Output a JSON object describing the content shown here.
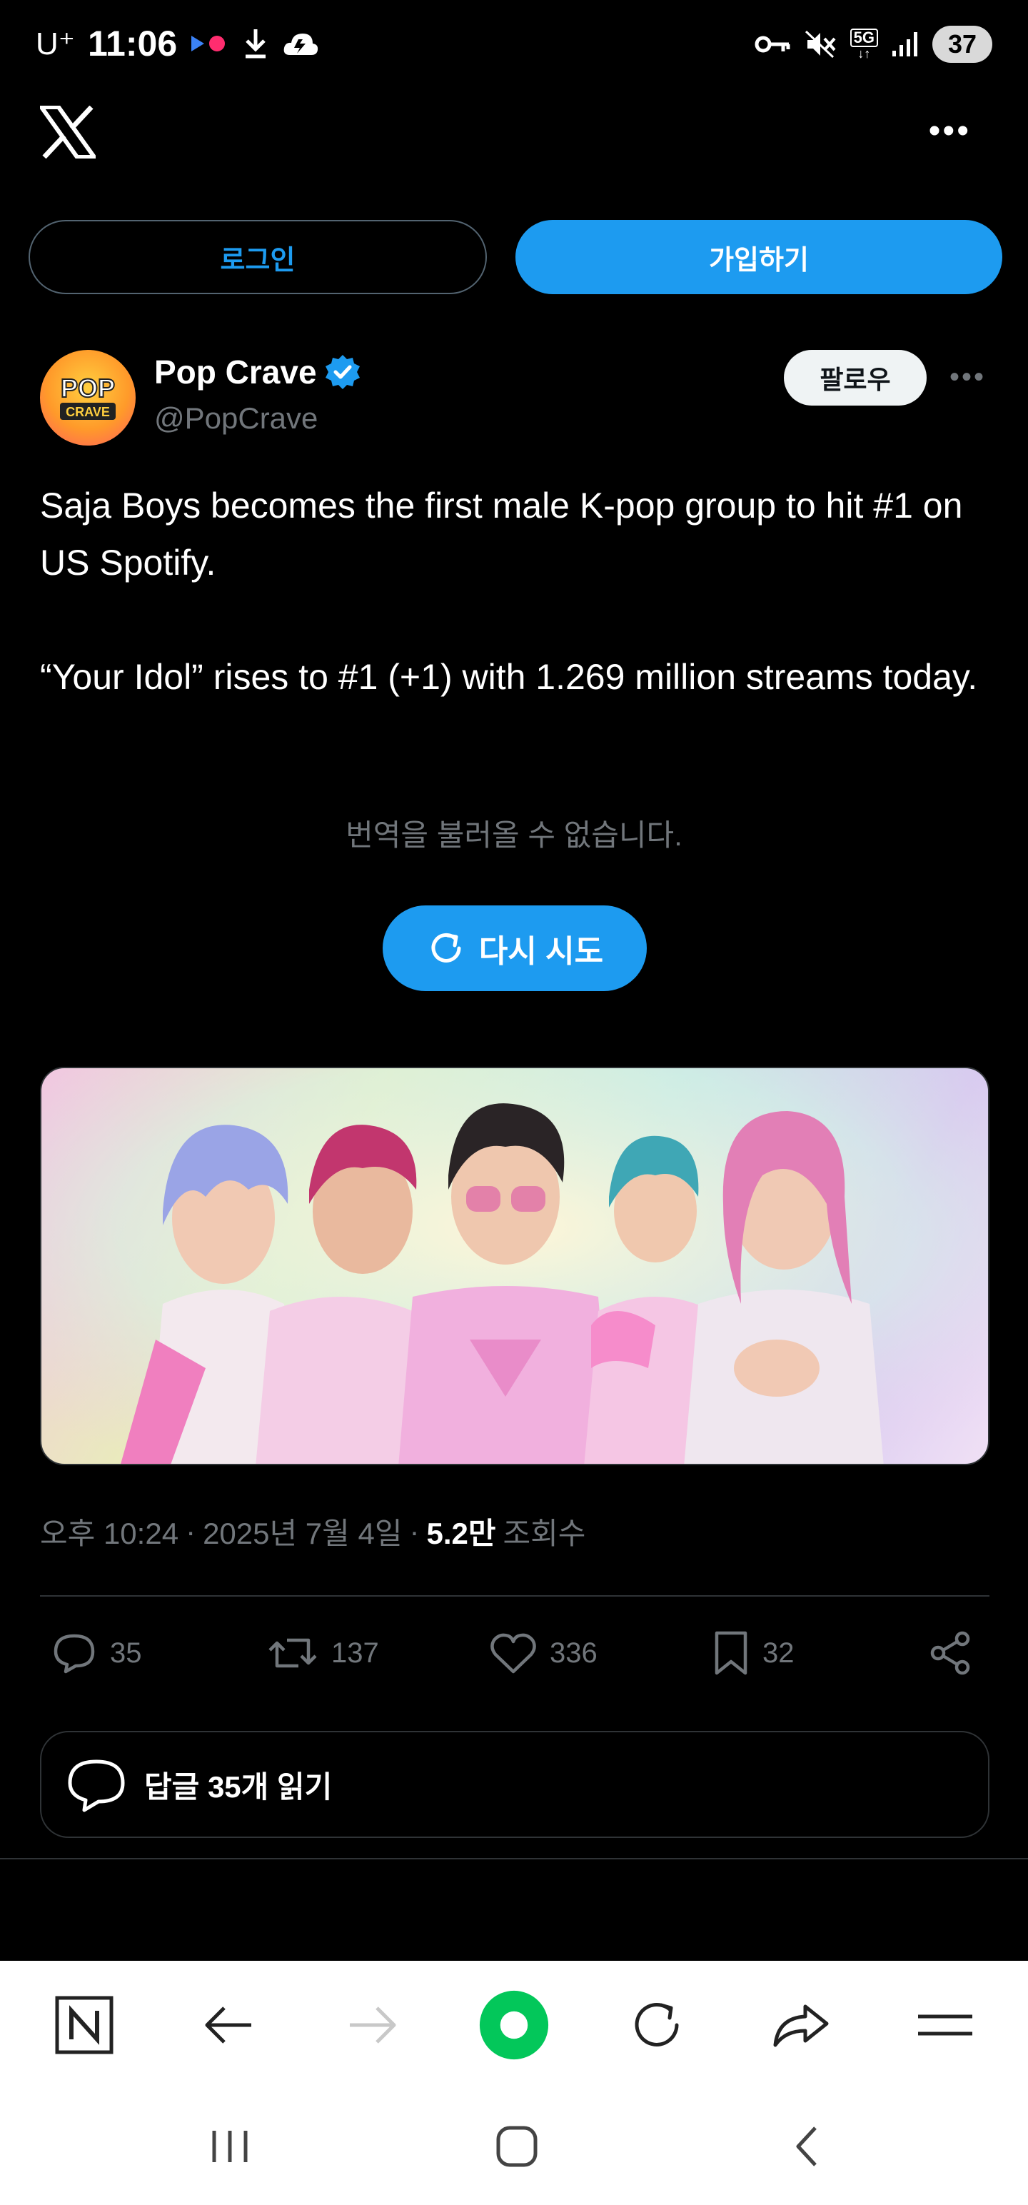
{
  "status_bar": {
    "carrier": "U⁺",
    "time": "11:06",
    "network": "5G",
    "battery": "37",
    "icons": [
      "media-dots-icon",
      "download-icon",
      "cloud-icon",
      "vpn-key-icon",
      "mute-icon",
      "signal-icon"
    ]
  },
  "header": {
    "logo": "x-logo-icon",
    "more": "•••"
  },
  "auth": {
    "login_label": "로그인",
    "signup_label": "가입하기"
  },
  "tweet": {
    "author": {
      "name": "Pop Crave",
      "handle": "@PopCrave",
      "avatar_text_top": "POP",
      "avatar_text_bottom": "CRAVE",
      "verified": true
    },
    "follow_label": "팔로우",
    "more": "•••",
    "text_lines": [
      "Saja Boys becomes the first male K-pop group to hit #1 on US Spotify.",
      "“Your Idol” rises to #1 (+1) with 1.269 million streams today."
    ],
    "translation_error": "번역을 불러올 수 없습니다.",
    "retry_label": "다시 시도",
    "meta": {
      "time": "오후 10:24",
      "sep": "·",
      "date": "2025년 7월 4일",
      "views_value": "5.2만",
      "views_label": "조회수"
    },
    "actions": {
      "replies": "35",
      "reposts": "137",
      "likes": "336",
      "bookmarks": "32"
    },
    "read_replies_label": "답글 35개 읽기"
  },
  "colors": {
    "accent": "#1d9bf0",
    "background": "#000000",
    "muted": "#71767b",
    "border": "#2f3336",
    "browser_green": "#03c75a"
  }
}
